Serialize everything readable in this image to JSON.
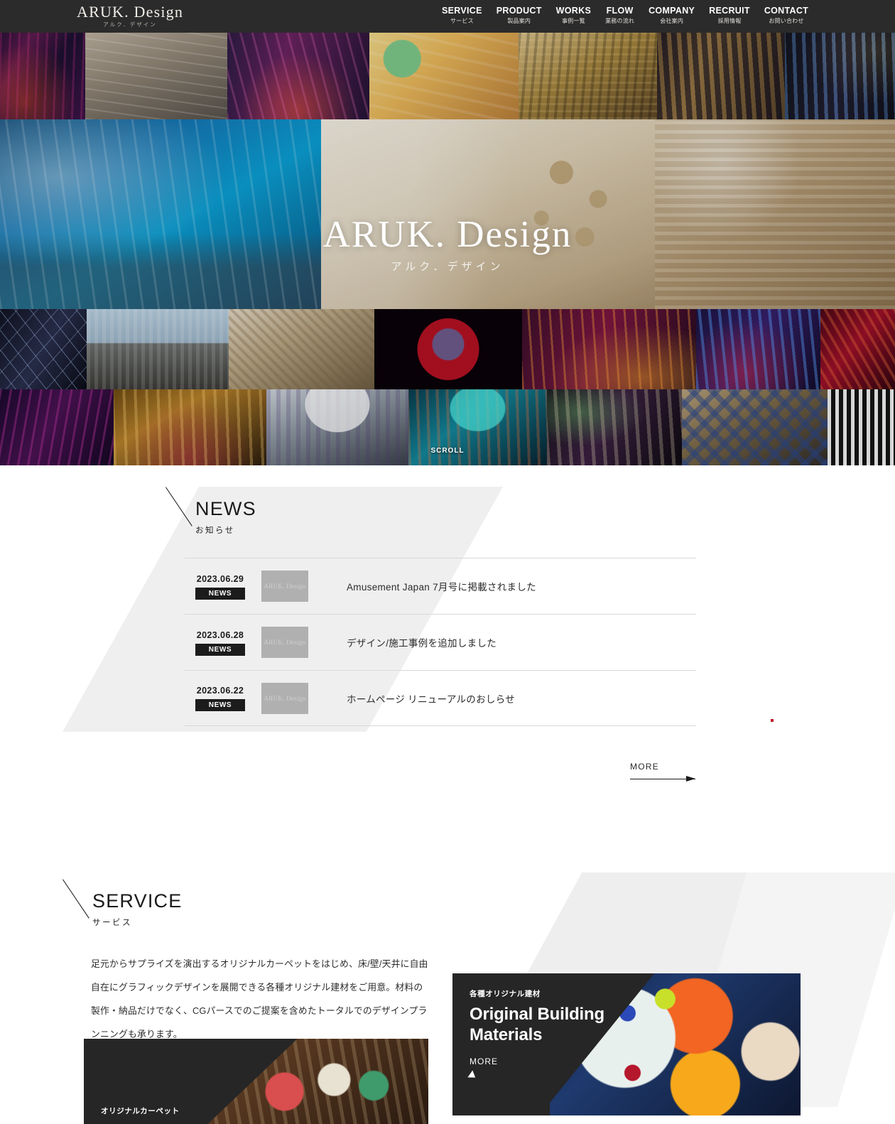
{
  "header": {
    "logo_main": "ARUK. Design",
    "logo_sub": "アルク．デザイン",
    "nav": [
      {
        "en": "SERVICE",
        "jp": "サービス"
      },
      {
        "en": "PRODUCT",
        "jp": "製品案内"
      },
      {
        "en": "WORKS",
        "jp": "事例一覧"
      },
      {
        "en": "FLOW",
        "jp": "業務の流れ"
      },
      {
        "en": "COMPANY",
        "jp": "会社案内"
      },
      {
        "en": "RECRUIT",
        "jp": "採用情報"
      },
      {
        "en": "CONTACT",
        "jp": "お問い合わせ"
      }
    ]
  },
  "hero": {
    "title": "ARUK. Design",
    "subtitle": "アルク．デザイン",
    "scroll_label": "SCROLL"
  },
  "news": {
    "heading_en": "NEWS",
    "heading_jp": "お知らせ",
    "thumb_logo": "ARUK. Design",
    "items": [
      {
        "date": "2023.06.29",
        "category": "NEWS",
        "title": "Amusement Japan 7月号に掲載されました"
      },
      {
        "date": "2023.06.28",
        "category": "NEWS",
        "title": "デザイン/施工事例を追加しました"
      },
      {
        "date": "2023.06.22",
        "category": "NEWS",
        "title": "ホームページ リニューアルのおしらせ"
      }
    ],
    "more_label": "MORE"
  },
  "service": {
    "heading_en": "SERVICE",
    "heading_jp": "サービス",
    "description": "足元からサプライズを演出するオリジナルカーペットをはじめ、床/壁/天井に自由自在にグラフィックデザインを展開できる各種オリジナル建材をご用意。材料の製作・納品だけでなく、CGパースでのご提案を含めたトータルでのデザインプランニングも承ります。",
    "cards": [
      {
        "kicker": "各種オリジナル建材",
        "title_line1": "Original Building",
        "title_line2": "Materials",
        "more_label": "MORE"
      },
      {
        "kicker": "オリジナルカーペット",
        "title_line1": "",
        "title_line2": "",
        "more_label": ""
      }
    ]
  },
  "colors": {
    "header_bg": "#2b2b2b",
    "accent_dark": "#1c1c1c",
    "diagonal_gray": "#efefef",
    "red_dot": "#c0182c"
  }
}
